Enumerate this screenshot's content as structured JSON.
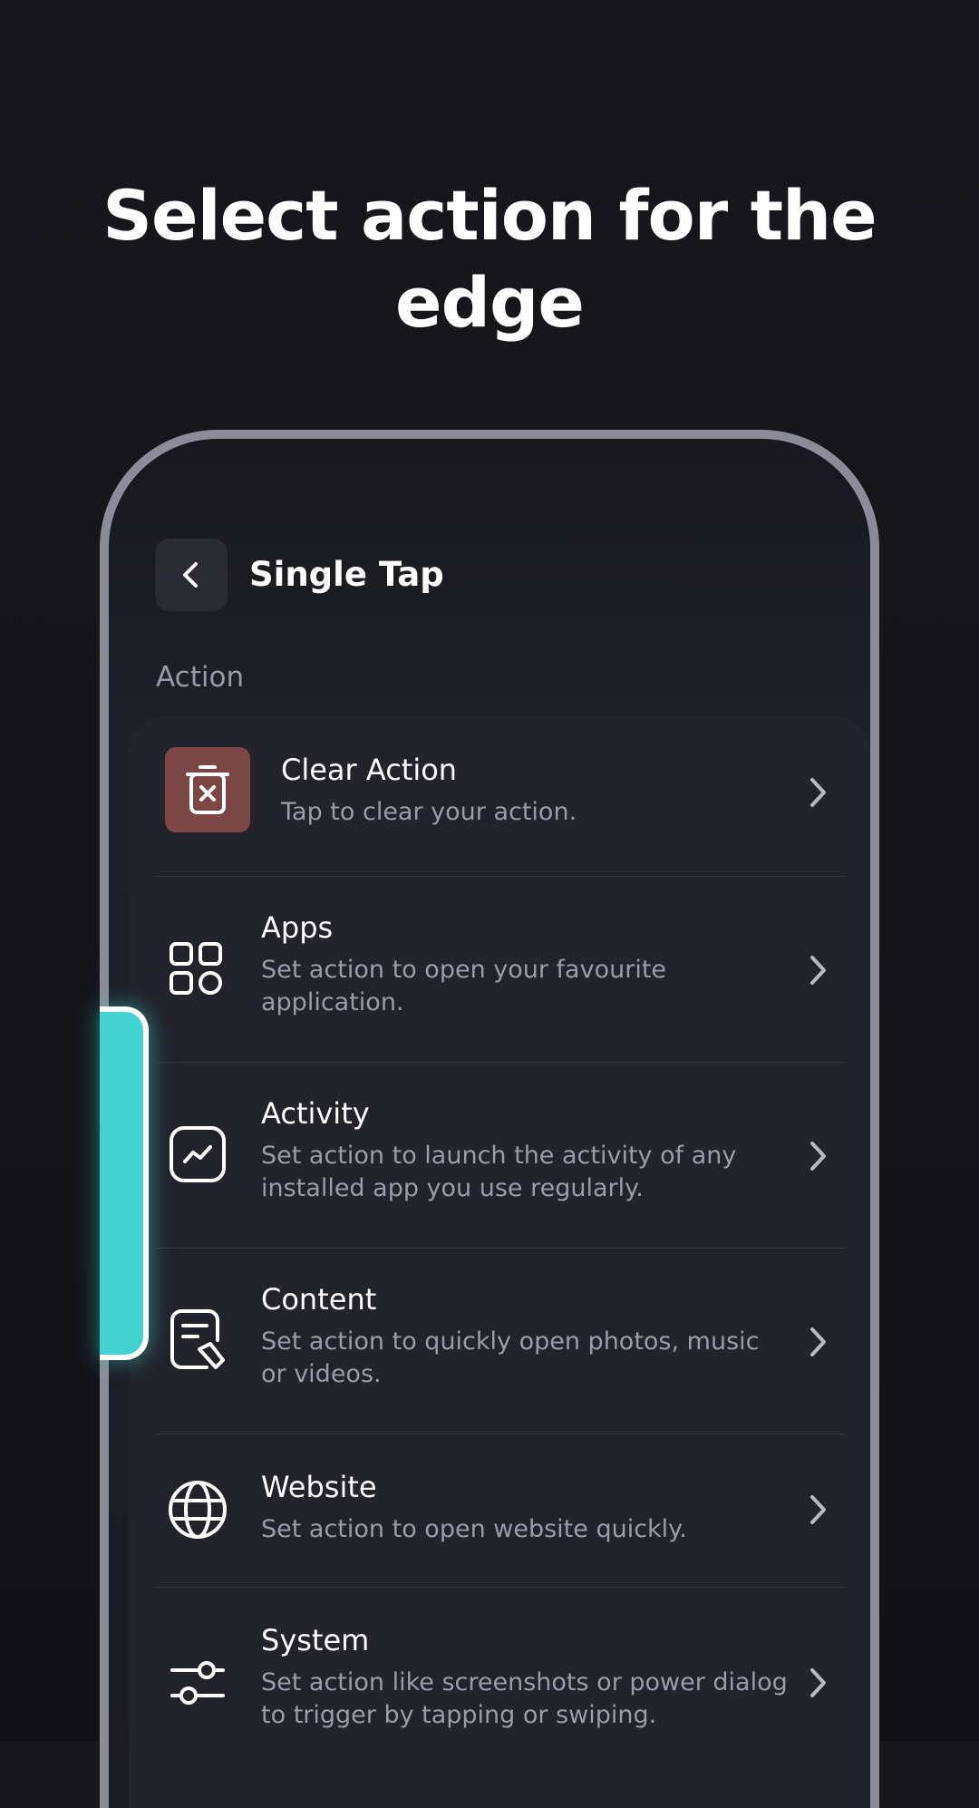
{
  "headline": "Select action for the edge",
  "screen": {
    "title": "Single Tap",
    "section_label": "Action"
  },
  "actions": [
    {
      "title": "Clear Action",
      "description": "Tap to clear your action.",
      "icon": "trash-x-icon"
    },
    {
      "title": "Apps",
      "description": "Set action to open your favourite application.",
      "icon": "apps-grid-icon"
    },
    {
      "title": "Activity",
      "description": "Set action to launch the activity of any installed app you use regularly.",
      "icon": "activity-chart-icon"
    },
    {
      "title": "Content",
      "description": "Set action to quickly open photos, music or videos.",
      "icon": "content-document-icon"
    },
    {
      "title": "Website",
      "description": "Set action to open website quickly.",
      "icon": "globe-icon"
    },
    {
      "title": "System",
      "description": "Set action like screenshots or power dialog to trigger by tapping or swiping.",
      "icon": "sliders-icon"
    }
  ],
  "colors": {
    "background": "#15151a",
    "phone_frame": "#8c8b98",
    "card": "#23232b",
    "clear_icon_bg": "#7b4645",
    "edge_handle": "#43d3d3",
    "secondary_text": "#9c9ca8"
  }
}
